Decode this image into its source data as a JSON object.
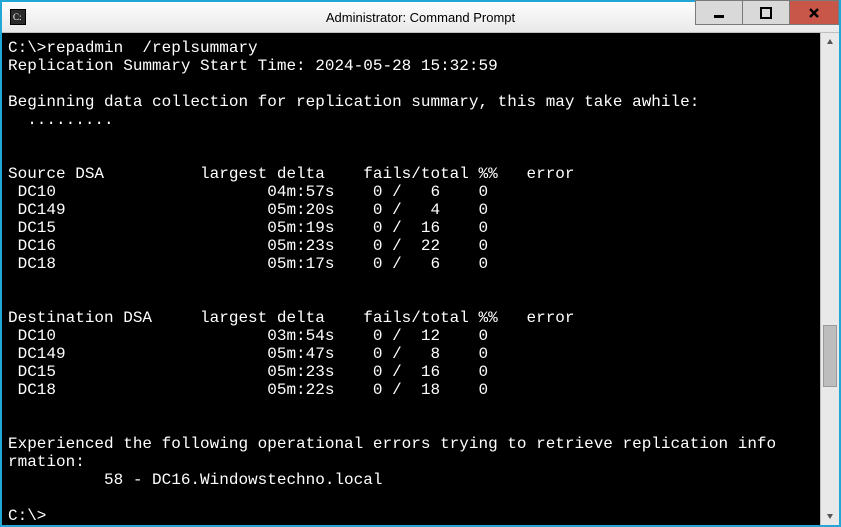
{
  "window": {
    "title": "Administrator: Command Prompt"
  },
  "prompt1": "C:\\>",
  "command": "repadmin  /replsummary",
  "summary_line": "Replication Summary Start Time: 2024-05-28 15:32:59",
  "begin_line": "Beginning data collection for replication summary, this may take awhile:",
  "dots": "  .........",
  "source_header": "Source DSA          largest delta    fails/total %%   error",
  "source_rows": [
    " DC10                      04m:57s    0 /   6    0",
    " DC149                     05m:20s    0 /   4    0",
    " DC15                      05m:19s    0 /  16    0",
    " DC16                      05m:23s    0 /  22    0",
    " DC18                      05m:17s    0 /   6    0"
  ],
  "dest_header": "Destination DSA     largest delta    fails/total %%   error",
  "dest_rows": [
    " DC10                      03m:54s    0 /  12    0",
    " DC149                     05m:47s    0 /   8    0",
    " DC15                      05m:23s    0 /  16    0",
    " DC18                      05m:22s    0 /  18    0"
  ],
  "err_line1": "Experienced the following operational errors trying to retrieve replication info",
  "err_line2": "rmation:",
  "err_detail": "          58 - DC16.Windowstechno.local",
  "prompt2": "C:\\>",
  "chart_data": {
    "type": "table",
    "tables": [
      {
        "title": "Source DSA",
        "columns": [
          "dsa",
          "largest_delta",
          "fails",
          "total",
          "percent",
          "error"
        ],
        "rows": [
          {
            "dsa": "DC10",
            "largest_delta": "04m:57s",
            "fails": 0,
            "total": 6,
            "percent": 0,
            "error": ""
          },
          {
            "dsa": "DC149",
            "largest_delta": "05m:20s",
            "fails": 0,
            "total": 4,
            "percent": 0,
            "error": ""
          },
          {
            "dsa": "DC15",
            "largest_delta": "05m:19s",
            "fails": 0,
            "total": 16,
            "percent": 0,
            "error": ""
          },
          {
            "dsa": "DC16",
            "largest_delta": "05m:23s",
            "fails": 0,
            "total": 22,
            "percent": 0,
            "error": ""
          },
          {
            "dsa": "DC18",
            "largest_delta": "05m:17s",
            "fails": 0,
            "total": 6,
            "percent": 0,
            "error": ""
          }
        ]
      },
      {
        "title": "Destination DSA",
        "columns": [
          "dsa",
          "largest_delta",
          "fails",
          "total",
          "percent",
          "error"
        ],
        "rows": [
          {
            "dsa": "DC10",
            "largest_delta": "03m:54s",
            "fails": 0,
            "total": 12,
            "percent": 0,
            "error": ""
          },
          {
            "dsa": "DC149",
            "largest_delta": "05m:47s",
            "fails": 0,
            "total": 8,
            "percent": 0,
            "error": ""
          },
          {
            "dsa": "DC15",
            "largest_delta": "05m:23s",
            "fails": 0,
            "total": 16,
            "percent": 0,
            "error": ""
          },
          {
            "dsa": "DC18",
            "largest_delta": "05m:22s",
            "fails": 0,
            "total": 18,
            "percent": 0,
            "error": ""
          }
        ]
      }
    ],
    "operational_errors": [
      {
        "code": 58,
        "target": "DC16.Windowstechno.local"
      }
    ],
    "start_time": "2024-05-28 15:32:59"
  }
}
